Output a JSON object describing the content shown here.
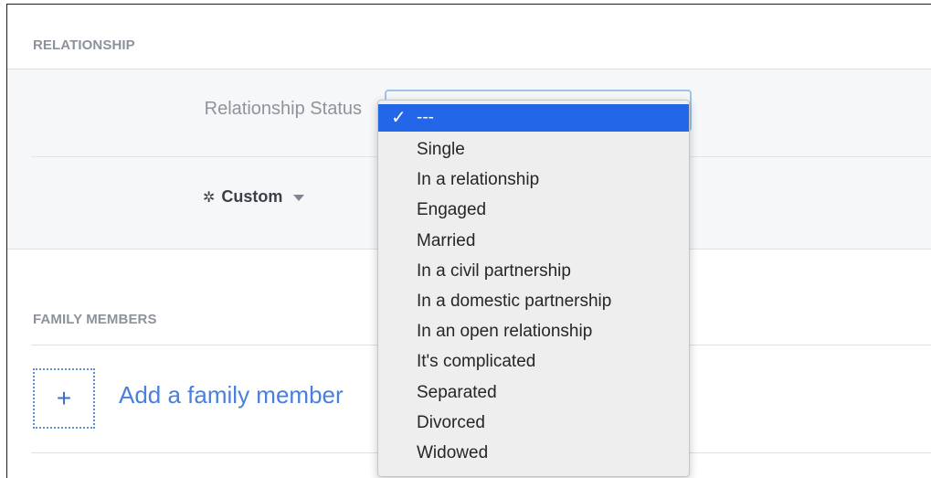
{
  "relationship": {
    "section_title": "RELATIONSHIP",
    "status_label": "Relationship Status",
    "privacy_label": "Custom",
    "privacy_icon": "gear-icon"
  },
  "dropdown": {
    "selected": "---",
    "options": [
      "---",
      "Single",
      "In a relationship",
      "Engaged",
      "Married",
      "In a civil partnership",
      "In a domestic partnership",
      "In an open relationship",
      "It's complicated",
      "Separated",
      "Divorced",
      "Widowed"
    ]
  },
  "family": {
    "section_title": "FAMILY MEMBERS",
    "add_label": "Add a family member",
    "add_icon": "+"
  },
  "colors": {
    "accent_blue": "#4a7fdc",
    "selection_blue": "#2466e8",
    "section_gray": "#8c929c"
  }
}
